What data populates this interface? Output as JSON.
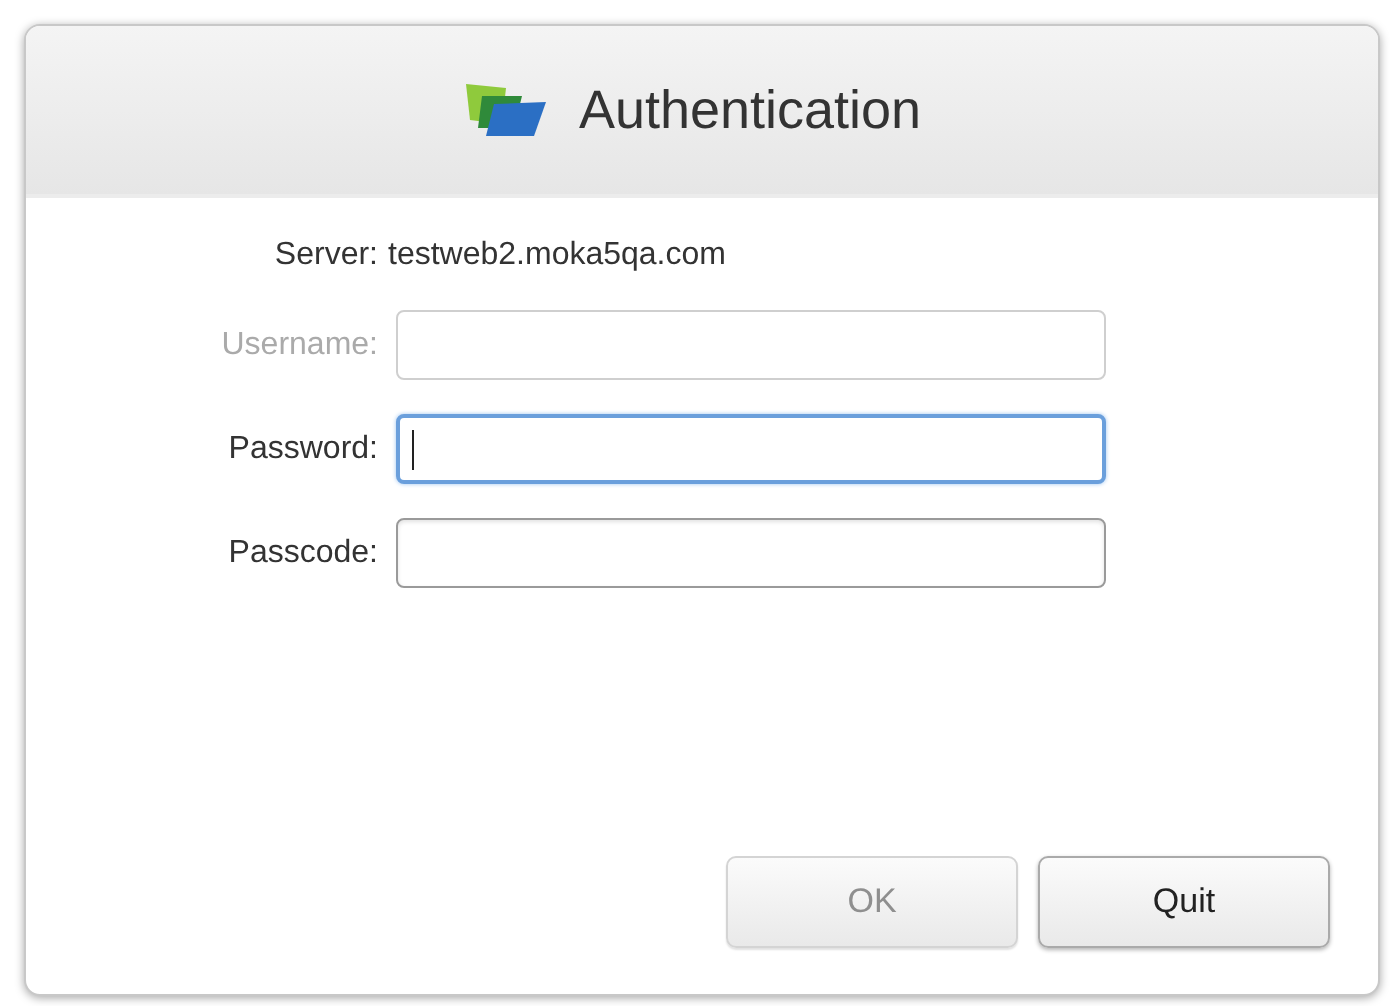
{
  "window": {
    "title": "Authentication"
  },
  "server": {
    "label": "Server:",
    "value": "testweb2.moka5qa.com"
  },
  "fields": [
    {
      "label": "Username:",
      "disabled": true,
      "focused": false
    },
    {
      "label": "Password:",
      "disabled": false,
      "focused": true
    },
    {
      "label": "Passcode:",
      "disabled": false,
      "focused": false
    }
  ],
  "buttons": [
    {
      "label": "OK",
      "disabled": true
    },
    {
      "label": "Quit",
      "disabled": false
    }
  ]
}
